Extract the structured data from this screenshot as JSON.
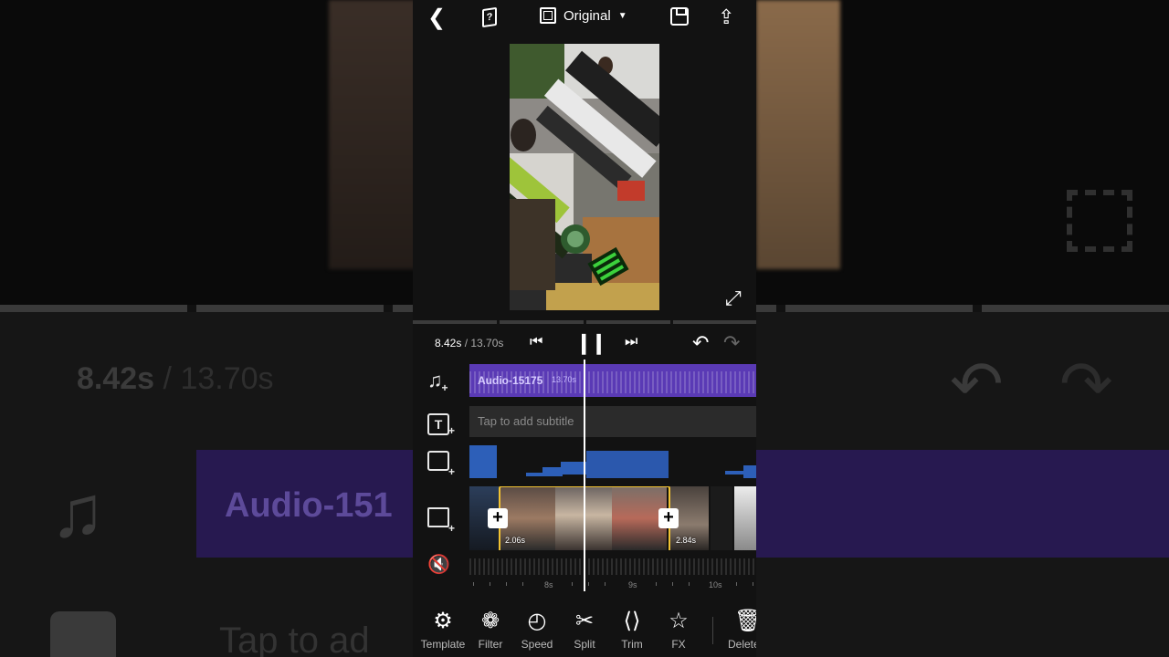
{
  "top_bar": {
    "aspect_label": "Original",
    "help_glyph": "?"
  },
  "playback": {
    "current_time": "8.42s",
    "separator": " / ",
    "total_time": "13.70s"
  },
  "tracks": {
    "audio": {
      "name": "Audio-15175",
      "duration": "13.70s"
    },
    "subtitle": {
      "placeholder": "Tap to add subtitle"
    },
    "video": {
      "selected_clip_duration": "2.06s",
      "next_clip_duration": "2.84s"
    }
  },
  "ruler": {
    "labels": [
      "8s",
      "9s",
      "10s"
    ]
  },
  "toolbar": {
    "items": [
      {
        "label": "Template",
        "icon": "template-icon"
      },
      {
        "label": "Filter",
        "icon": "filter-icon"
      },
      {
        "label": "Speed",
        "icon": "speed-icon"
      },
      {
        "label": "Split",
        "icon": "split-icon"
      },
      {
        "label": "Trim",
        "icon": "trim-icon"
      },
      {
        "label": "FX",
        "icon": "fx-icon"
      },
      {
        "label": "Delete",
        "icon": "trash-icon"
      }
    ]
  },
  "background_zoom": {
    "time": "8.42s",
    "separator": " / ",
    "total": "13.70s",
    "audio_fragment": "Audio-151",
    "tap_fragment": "Tap to ad"
  },
  "colors": {
    "audio_track": "#5a3ab5",
    "selection": "#f1c232",
    "sticker": "#2d5fb8",
    "panel": "#121212"
  }
}
